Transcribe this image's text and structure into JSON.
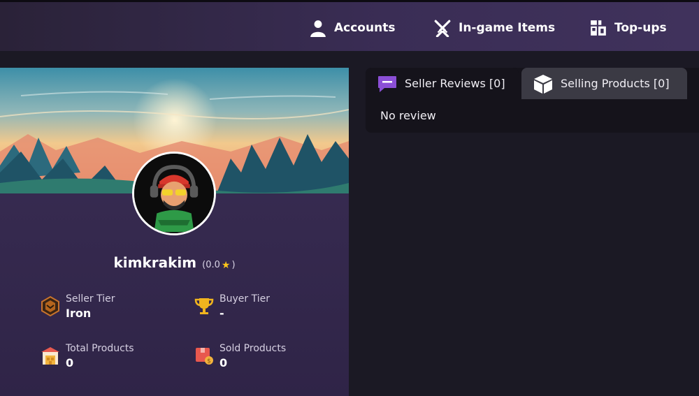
{
  "nav": {
    "accounts_label": "Accounts",
    "ingame_label": "In-game Items",
    "topups_label": "Top-ups"
  },
  "profile": {
    "username": "kimkrakim",
    "rating_text": "(0.0",
    "rating_close": ")",
    "seller_tier_label": "Seller Tier",
    "seller_tier_value": "Iron",
    "buyer_tier_label": "Buyer Tier",
    "buyer_tier_value": "-",
    "total_products_label": "Total Products",
    "total_products_value": "0",
    "sold_products_label": "Sold Products",
    "sold_products_value": "0"
  },
  "tabs": {
    "reviews_label": "Seller Reviews [0]",
    "products_label": "Selling Products [0]",
    "empty_text": "No review"
  },
  "colors": {
    "accent_purple": "#8b4fd6",
    "star": "#ffc61a",
    "panel_dark": "#15131b"
  }
}
